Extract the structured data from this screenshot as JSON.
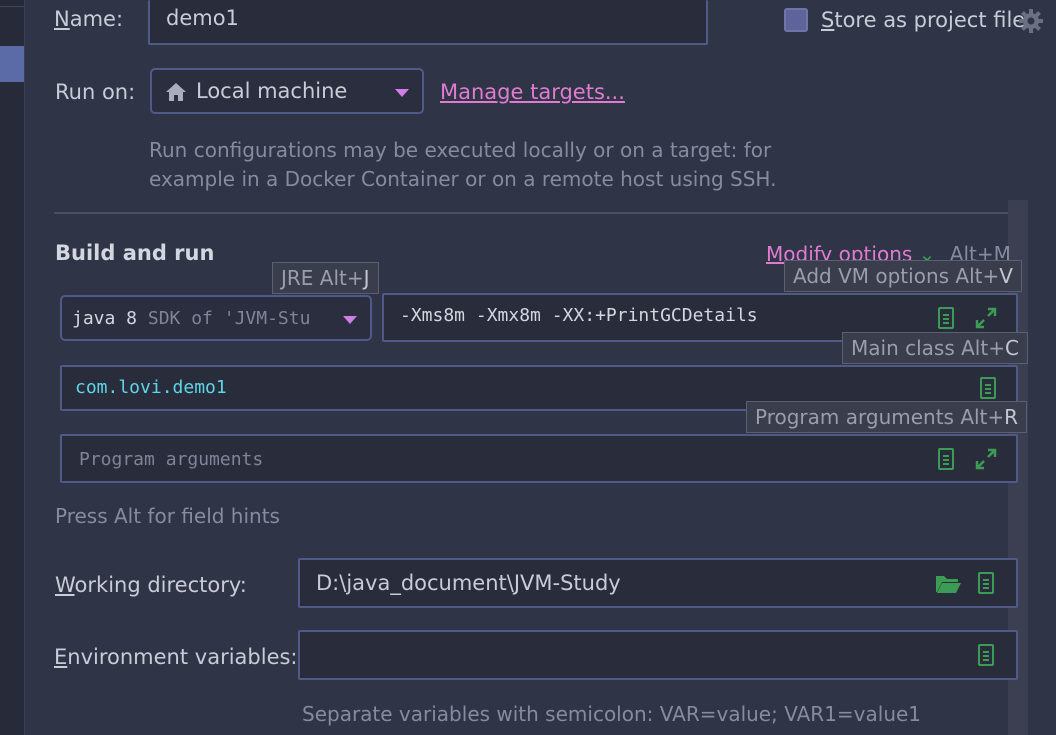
{
  "name": {
    "label": "Name:",
    "value": "demo1"
  },
  "store": {
    "label": "Store as project file",
    "checked": false
  },
  "run_on": {
    "label": "Run on:",
    "target": "Local machine",
    "manage_link": "Manage targets...",
    "description_line1": "Run configurations may be executed locally or on a target: for",
    "description_line2": "example in a Docker Container or on a remote host using SSH."
  },
  "build": {
    "title": "Build and run",
    "modify_options": "Modify options",
    "modify_shortcut": "Alt+M",
    "jre_value_bold": "java 8",
    "jre_value_rest": "SDK of 'JVM-Stu",
    "vm_options": "-Xms8m -Xmx8m -XX:+PrintGCDetails",
    "main_class": "com.lovi.demo1",
    "program_args_placeholder": "Program arguments",
    "press_alt_hint": "Press Alt for field hints"
  },
  "tooltips": {
    "jre": "JRE Alt+",
    "jre_key": "J",
    "vm": "Add VM options Alt+",
    "vm_key": "V",
    "main": "Main class Alt+",
    "main_key": "C",
    "args": "Program arguments Alt+",
    "args_key": "R"
  },
  "working_dir": {
    "label": "Working directory:",
    "value": "D:\\java_document\\JVM-Study"
  },
  "env": {
    "label": "Environment variables:",
    "value": "",
    "hint": "Separate variables with semicolon: VAR=value; VAR1=value1"
  },
  "colors": {
    "accent_link": "#e07bd0",
    "focus_border": "#505a86",
    "icon_green": "#3c9b55"
  }
}
